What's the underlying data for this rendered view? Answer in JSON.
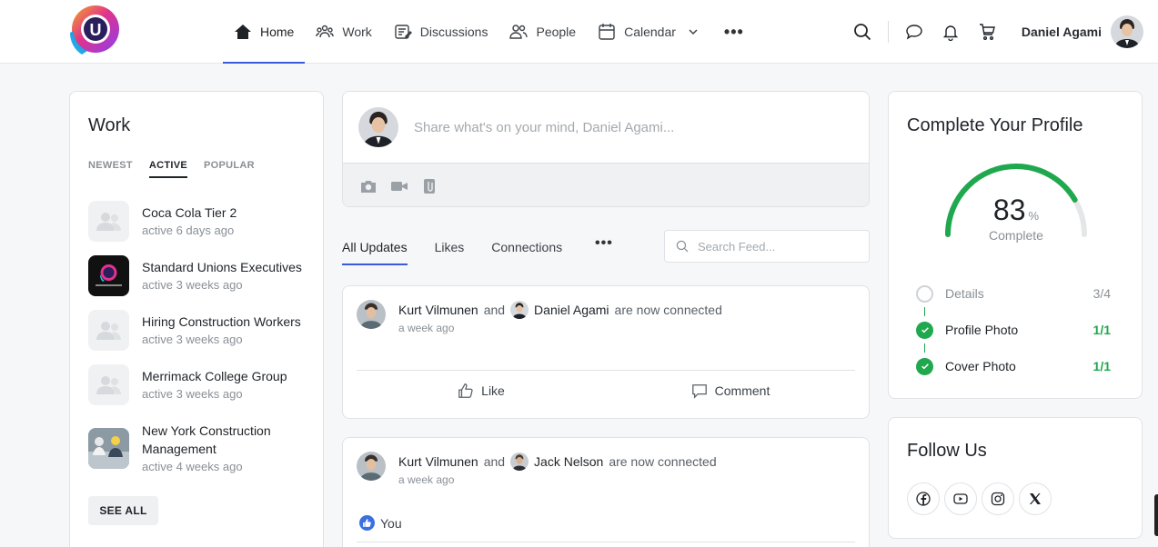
{
  "brand": {
    "logo_letter": "U"
  },
  "nav": {
    "items": [
      {
        "label": "Home",
        "icon": "home-icon",
        "active": true
      },
      {
        "label": "Work",
        "icon": "people-group-icon"
      },
      {
        "label": "Discussions",
        "icon": "discussions-icon"
      },
      {
        "label": "People",
        "icon": "people-icon"
      },
      {
        "label": "Calendar",
        "icon": "calendar-icon"
      }
    ],
    "more": "•••"
  },
  "topbar": {
    "user_name": "Daniel Agami"
  },
  "work_widget": {
    "title": "Work",
    "tabs": [
      "NEWEST",
      "ACTIVE",
      "POPULAR"
    ],
    "active_tab": "ACTIVE",
    "groups": [
      {
        "name": "Coca Cola Tier 2",
        "meta": "active 6 days ago",
        "thumb": "placeholder"
      },
      {
        "name": "Standard Unions Executives",
        "meta": "active 3 weeks ago",
        "thumb": "logo"
      },
      {
        "name": "Hiring Construction Workers",
        "meta": "active 3 weeks ago",
        "thumb": "placeholder"
      },
      {
        "name": "Merrimack College Group",
        "meta": "active 3 weeks ago",
        "thumb": "placeholder"
      },
      {
        "name": "New York Construction Management",
        "meta": "active 4 weeks ago",
        "thumb": "photo"
      }
    ],
    "see_all": "SEE ALL"
  },
  "composer": {
    "placeholder": "Share what's on your mind, Daniel Agami..."
  },
  "feed": {
    "tabs": [
      "All Updates",
      "Likes",
      "Connections"
    ],
    "active_tab": "All Updates",
    "more": "•••",
    "search_placeholder": "Search Feed...",
    "posts": [
      {
        "actor": "Kurt Vilmunen",
        "joiner": "and",
        "target": "Daniel Agami",
        "text": "are now connected",
        "time": "a week ago",
        "like_label": "Like",
        "comment_label": "Comment"
      },
      {
        "actor": "Kurt Vilmunen",
        "joiner": "and",
        "target": "Jack Nelson",
        "text": "are now connected",
        "time": "a week ago",
        "liked_by": "You"
      }
    ]
  },
  "profile": {
    "title": "Complete Your Profile",
    "percent": 83,
    "percent_sign": "%",
    "complete_label": "Complete",
    "items": [
      {
        "label": "Details",
        "count": "3/4",
        "done": false
      },
      {
        "label": "Profile Photo",
        "count": "1/1",
        "done": true
      },
      {
        "label": "Cover Photo",
        "count": "1/1",
        "done": true
      }
    ],
    "colors": {
      "progress": "#1fa84e",
      "track": "#e4e6e8"
    }
  },
  "follow": {
    "title": "Follow Us",
    "networks": [
      "facebook-icon",
      "youtube-icon",
      "instagram-icon",
      "x-icon"
    ]
  },
  "colors": {
    "accent": "#3c5bd8",
    "success": "#1fa84e"
  }
}
